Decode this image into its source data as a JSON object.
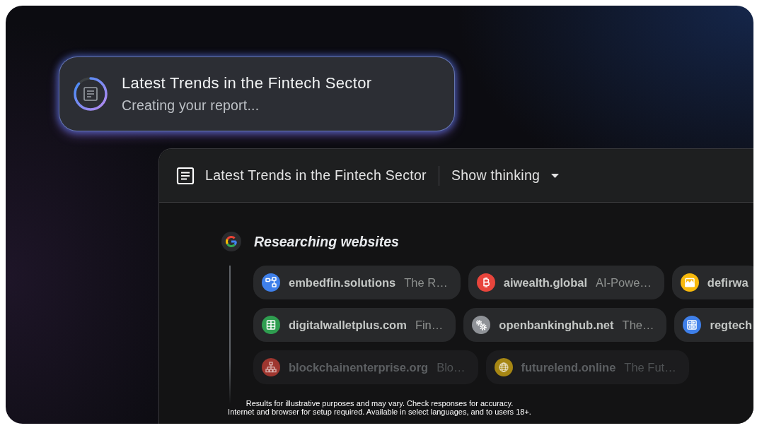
{
  "report_card": {
    "title": "Latest Trends in the Fintech Sector",
    "status": "Creating your report..."
  },
  "panel": {
    "title": "Latest Trends in the Fintech Sector",
    "toggle_label": "Show thinking"
  },
  "research": {
    "heading": "Researching websites",
    "rows": [
      {
        "sources": [
          {
            "domain": "embedfin.solutions",
            "snippet": "The R…",
            "color": "#3f80ea",
            "faded": false
          },
          {
            "domain": "aiwealth.global",
            "snippet": "AI-Powe…",
            "color": "#e8453c",
            "faded": false
          },
          {
            "domain": "defirwa",
            "color": "#f8b90c",
            "faded": false
          }
        ]
      },
      {
        "sources": [
          {
            "domain": "digitalwalletplus.com",
            "snippet": "Fin…",
            "color": "#2f9e50",
            "faded": false
          },
          {
            "domain": "openbankinghub.net",
            "snippet": "The…",
            "color": "#8f9297",
            "faded": false
          },
          {
            "domain": "regtech",
            "color": "#3f80ea",
            "faded": false
          }
        ]
      },
      {
        "sources": [
          {
            "domain": "blockchainenterprise.org",
            "snippet": "Blo…",
            "color": "#9e362f",
            "faded": true
          },
          {
            "domain": "futurelend.online",
            "snippet": "The Fut…",
            "color": "#a68613",
            "faded": true
          }
        ]
      }
    ]
  },
  "disclaimer": [
    "Results for illustrative purposes and may vary. Check responses for accuracy.",
    "Internet and browser for setup required. Available in select languages, and to users 18+."
  ]
}
